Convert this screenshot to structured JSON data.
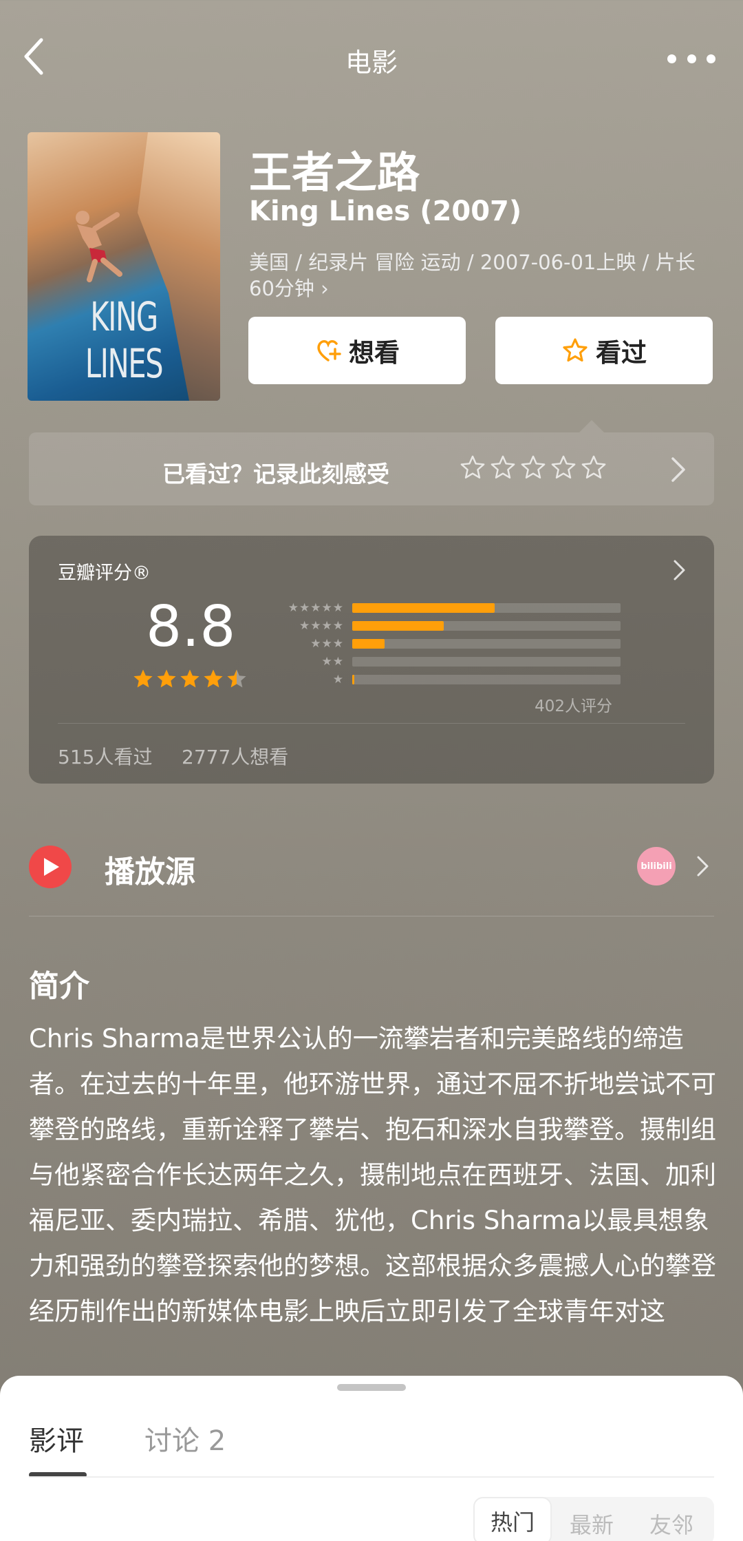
{
  "topbar": {
    "title": "电影"
  },
  "poster": {
    "text": "KING LINES"
  },
  "movie": {
    "title": "王者之路",
    "subtitle": "King Lines (2007)",
    "meta": "美国 / 纪录片 冒险 运动 / 2007-06-01上映 / 片长60分钟 ›"
  },
  "actions": {
    "want_label": "想看",
    "seen_label": "看过"
  },
  "record": {
    "label": "已看过？记录此刻感受",
    "star_count": 5
  },
  "rating": {
    "label": "豆瓣评分®",
    "score": "8.8",
    "stars_value": 4.5,
    "distribution": [
      {
        "stars": "★★★★★",
        "fraction": 0.53
      },
      {
        "stars": "★★★★",
        "fraction": 0.34
      },
      {
        "stars": "★★★",
        "fraction": 0.12
      },
      {
        "stars": "★★",
        "fraction": 0.0
      },
      {
        "stars": "★",
        "fraction": 0.005
      }
    ],
    "count_text": "402人评分",
    "seen_text": "515人看过",
    "want_text": "2777人想看"
  },
  "play": {
    "label": "播放源",
    "provider_text": "bilibili"
  },
  "intro": {
    "title": "简介",
    "text": "Chris Sharma是世界公认的一流攀岩者和完美路线的缔造者。在过去的十年里，他环游世界，通过不屈不折地尝试不可攀登的路线，重新诠释了攀岩、抱石和深水自我攀登。摄制组与他紧密合作长达两年之久，摄制地点在西班牙、法国、加利福尼亚、委内瑞拉、希腊、犹他，Chris Sharma以最具想象力和强劲的攀登探索他的梦想。这部根据众多震撼人心的攀登经历制作出的新媒体电影上映后立即引发了全球青年对这"
  },
  "sheet": {
    "tab_review": "影评",
    "tab_discuss": "讨论 2",
    "sort_hot": "热门",
    "sort_new": "最新",
    "sort_friend": "友邻"
  },
  "colors": {
    "accent": "#ff9f0a",
    "play_red": "#f04848"
  }
}
